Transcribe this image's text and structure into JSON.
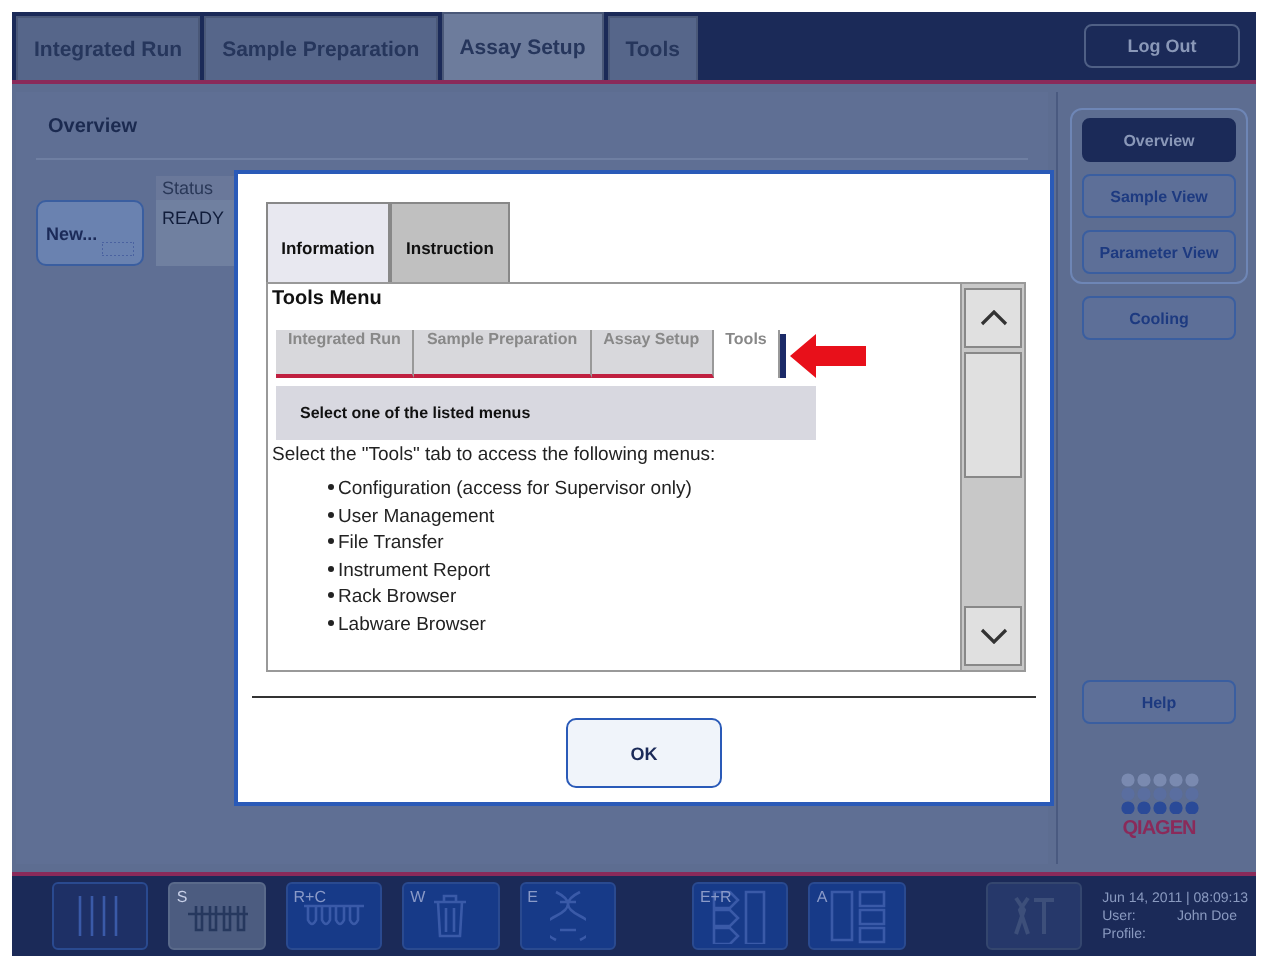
{
  "main_tabs": [
    {
      "label": "Integrated Run",
      "selected": false
    },
    {
      "label": "Sample Preparation",
      "selected": false
    },
    {
      "label": "Assay Setup",
      "selected": true
    },
    {
      "label": "Tools",
      "selected": false
    }
  ],
  "log_out": "Log Out",
  "overview": {
    "title": "Overview",
    "status_header": "Status",
    "status": "READY",
    "new_button": "New..."
  },
  "side_nav": [
    {
      "label": "Overview",
      "selected": true
    },
    {
      "label": "Sample View",
      "selected": false
    },
    {
      "label": "Parameter View",
      "selected": false
    }
  ],
  "cooling": "Cooling",
  "help": "Help",
  "logo": "QIAGEN",
  "toolbar": [
    {
      "kind": "rack",
      "selected": false
    },
    {
      "kind": "sample",
      "label": "S",
      "selected": true
    },
    {
      "kind": "reagent",
      "label": "R+C",
      "selected": false
    },
    {
      "kind": "waste",
      "label": "W",
      "selected": false
    },
    {
      "kind": "eluate",
      "label": "E",
      "selected": false
    },
    {
      "kind": "eluate_reagent",
      "label": "E+R",
      "selected": false
    },
    {
      "kind": "assay",
      "label": "A",
      "selected": false
    }
  ],
  "status_info": {
    "datetime": "Jun 14, 2011 | 08:09:13",
    "user_label": "User:",
    "user": "John Doe",
    "profile_label": "Profile:"
  },
  "dialog": {
    "tabs": [
      {
        "label": "Information",
        "selected": true
      },
      {
        "label": "Instruction",
        "selected": false
      }
    ],
    "heading": "Tools Menu",
    "example_tabs": [
      {
        "label": "Integrated Run",
        "selected": false
      },
      {
        "label": "Sample Preparation",
        "selected": false
      },
      {
        "label": "Assay Setup",
        "selected": false
      },
      {
        "label": "Tools",
        "selected": true
      }
    ],
    "panel_title": "Select one of the listed menus",
    "intro": "Select the \"Tools\" tab to access the following menus:",
    "items": [
      "Configuration (access for Supervisor only)",
      "User Management",
      "File Transfer",
      "Instrument Report",
      "Rack Browser",
      "Labware Browser"
    ],
    "ok": "OK"
  }
}
